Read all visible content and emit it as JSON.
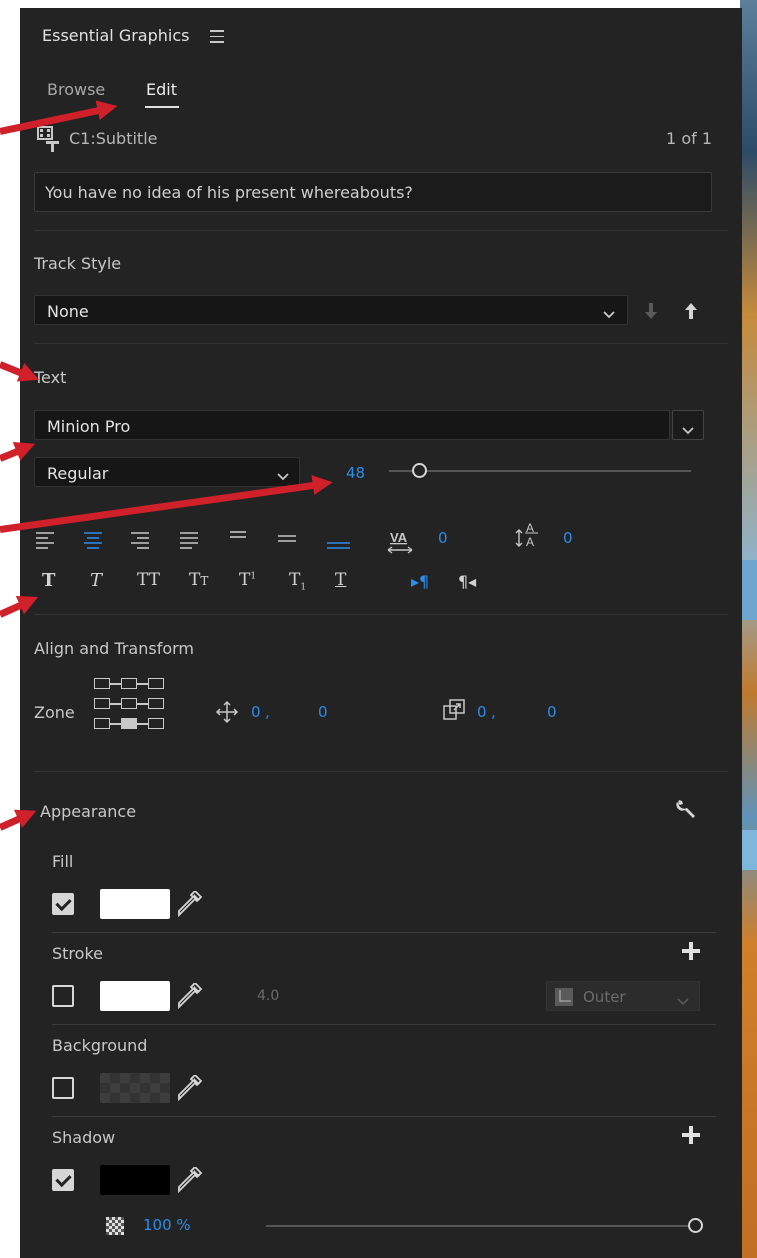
{
  "panel": {
    "title": "Essential Graphics",
    "menu_icon": "hamburger-icon",
    "tabs": [
      {
        "label": "Browse",
        "active": false
      },
      {
        "label": "Edit",
        "active": true
      }
    ]
  },
  "caption": {
    "clip_name": "C1:Subtitle",
    "counter": "1 of 1",
    "text": "You have no idea of his present whereabouts?"
  },
  "track_style": {
    "label": "Track Style",
    "value": "None"
  },
  "text_section": {
    "label": "Text",
    "font": "Minion Pro",
    "style": "Regular",
    "size": "48",
    "size_slider_fraction": 0.1,
    "kerning": "0",
    "leading": "0",
    "align_icons": [
      "align-left-icon",
      "align-center-icon",
      "align-right-icon",
      "justify-icon",
      "justify-last-left-icon",
      "justify-last-center-icon",
      "justify-all-icon"
    ],
    "style_icons": [
      "faux-bold-icon",
      "faux-italic-icon",
      "all-caps-icon",
      "small-caps-icon",
      "superscript-icon",
      "subscript-icon",
      "underline-icon"
    ],
    "direction_icons": [
      "ltr-paragraph-icon",
      "rtl-paragraph-icon"
    ]
  },
  "align_transform": {
    "label": "Align and Transform",
    "zone_label": "Zone",
    "position_x": "0",
    "position_sep": ",",
    "position_y": "0",
    "anchor_x": "0",
    "anchor_sep": ",",
    "anchor_y": "0"
  },
  "appearance": {
    "label": "Appearance",
    "fill": {
      "label": "Fill",
      "checked": true,
      "color": "#ffffff"
    },
    "stroke": {
      "label": "Stroke",
      "checked": false,
      "color": "#ffffff",
      "width": "4.0",
      "type": "Outer"
    },
    "background": {
      "label": "Background",
      "checked": false
    },
    "shadow": {
      "label": "Shadow",
      "checked": true,
      "color": "#000000",
      "opacity": "100 %",
      "opacity_fraction": 1.0
    }
  },
  "colors": {
    "panel_bg": "#232323",
    "accent_blue": "#2d8ceb",
    "annotation_red": "#d0202a"
  }
}
